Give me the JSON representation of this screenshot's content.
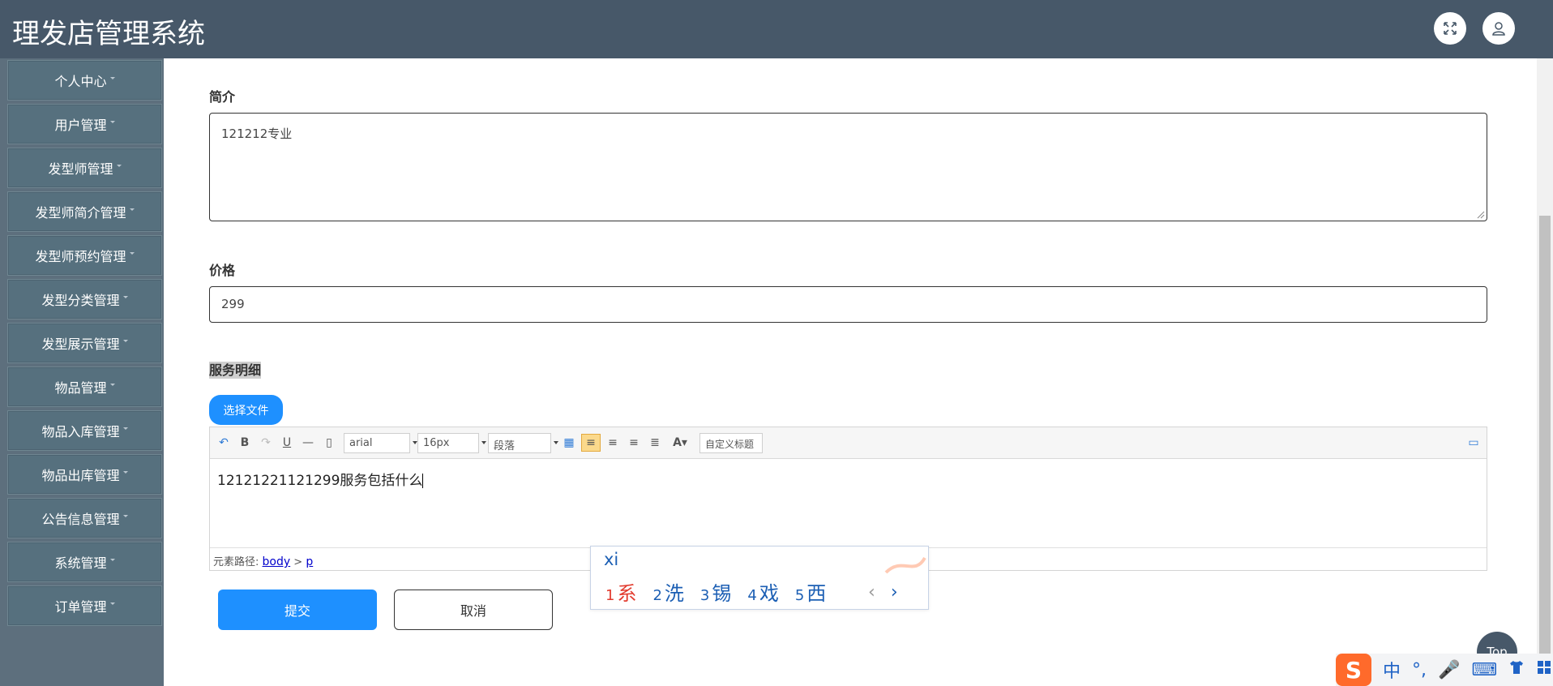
{
  "header": {
    "title": "理发店管理系统"
  },
  "sidebar": {
    "items": [
      {
        "label": "个人中心"
      },
      {
        "label": "用户管理"
      },
      {
        "label": "发型师管理"
      },
      {
        "label": "发型师简介管理"
      },
      {
        "label": "发型师预约管理"
      },
      {
        "label": "发型分类管理"
      },
      {
        "label": "发型展示管理"
      },
      {
        "label": "物品管理"
      },
      {
        "label": "物品入库管理"
      },
      {
        "label": "物品出库管理"
      },
      {
        "label": "公告信息管理"
      },
      {
        "label": "系统管理"
      },
      {
        "label": "订单管理"
      }
    ]
  },
  "form": {
    "intro_label": "简介",
    "intro_value": "121212专业",
    "price_label": "价格",
    "price_value": "299",
    "detail_label": "服务明细",
    "file_button": "选择文件"
  },
  "editor": {
    "font_family": "arial",
    "font_size": "16px",
    "paragraph": "段落",
    "custom_title": "自定义标题",
    "content": "12121221121299服务包括什么",
    "path_label": "元素路径:",
    "path_body": "body",
    "path_sep": ">",
    "path_p": "p"
  },
  "ime": {
    "input": "xi",
    "candidates": [
      {
        "num": "1",
        "text": "系"
      },
      {
        "num": "2",
        "text": "洗"
      },
      {
        "num": "3",
        "text": "锡"
      },
      {
        "num": "4",
        "text": "戏"
      },
      {
        "num": "5",
        "text": "西"
      }
    ],
    "prev": "‹",
    "next": "›"
  },
  "actions": {
    "submit": "提交",
    "cancel": "取消"
  },
  "top_button": "Top",
  "tray": {
    "logo": "S",
    "lang": "中",
    "punct": "°,",
    "mic": "🎤",
    "keyboard": "⌨"
  },
  "colors": {
    "header_bg": "#475869",
    "sidebar_bg": "#5d6f7d",
    "menu_item_bg": "#56707e",
    "primary": "#1e90ff",
    "ime_first": "#e23b2e",
    "ime_text": "#1c5fb4"
  },
  "icons": {
    "fullscreen": "expand-arrows-icon",
    "user": "user-avatar-icon"
  }
}
